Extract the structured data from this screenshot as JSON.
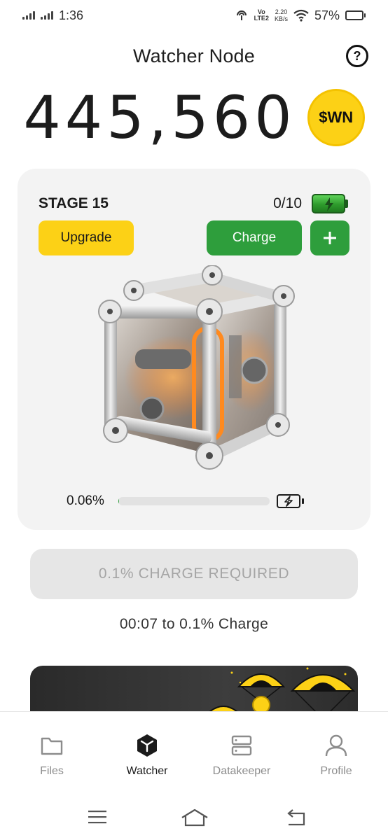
{
  "status_bar": {
    "time": "1:36",
    "volte_top": "Vo",
    "volte_bottom": "LTE2",
    "netspeed_value": "2.20",
    "netspeed_unit": "KB/s",
    "battery_percent": "57%",
    "battery_level": 0.57
  },
  "header": {
    "title": "Watcher Node",
    "help_symbol": "?"
  },
  "balance": {
    "value": "445,560",
    "token_symbol": "$WN",
    "token_color": "#fcd116"
  },
  "stage_card": {
    "stage_label": "STAGE 15",
    "charge_count": "0/10",
    "upgrade_label": "Upgrade",
    "charge_label": "Charge",
    "plus_icon": "plus-icon",
    "progress_text": "0.06%",
    "progress_fraction": 0.0006
  },
  "charge_required": {
    "label": "0.1% CHARGE REQUIRED"
  },
  "countdown": {
    "text": "00:07 to 0.1% Charge"
  },
  "bottom_nav": {
    "items": [
      {
        "label": "Files",
        "icon": "folder-icon",
        "active": false
      },
      {
        "label": "Watcher",
        "icon": "cube-icon",
        "active": true
      },
      {
        "label": "Datakeeper",
        "icon": "server-icon",
        "active": false
      },
      {
        "label": "Profile",
        "icon": "user-icon",
        "active": false
      }
    ]
  },
  "colors": {
    "accent_green": "#2e9e3c",
    "accent_yellow": "#fcd116",
    "card_bg": "#f3f3f3",
    "disabled_text": "#a5a5a5"
  }
}
